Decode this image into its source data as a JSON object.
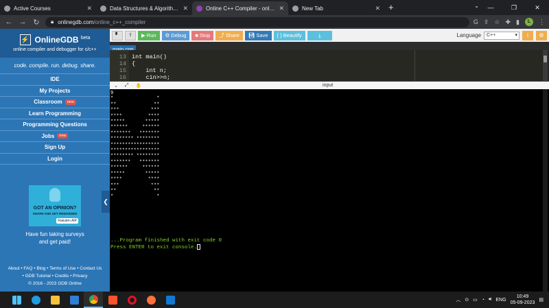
{
  "browser": {
    "tabs": [
      {
        "title": "Active Courses",
        "active": false
      },
      {
        "title": "Data Structures & Algorithms M...",
        "active": false
      },
      {
        "title": "Online C++ Compiler - online ed...",
        "active": true
      },
      {
        "title": "New Tab",
        "active": false
      }
    ],
    "url_host": "onlinegdb.com",
    "url_path": "/online_c++_compiler",
    "profile_initial": "L"
  },
  "sidebar": {
    "brand": "OnlineGDB",
    "brand_sup": "beta",
    "brand_sub": "online compiler and debugger for c/c++",
    "tagline": "code. compile. run. debug. share.",
    "nav": [
      {
        "label": "IDE",
        "badge": ""
      },
      {
        "label": "My Projects",
        "badge": ""
      },
      {
        "label": "Classroom",
        "badge": "new"
      },
      {
        "label": "Learn Programming",
        "badge": ""
      },
      {
        "label": "Programming Questions",
        "badge": ""
      },
      {
        "label": "Jobs",
        "badge": "new"
      },
      {
        "label": "Sign Up",
        "badge": ""
      },
      {
        "label": "Login",
        "badge": ""
      }
    ],
    "ad": {
      "line1": "GOT AN OPINION?",
      "line2": "SHARE AND GET REWARDED",
      "sponsor": "Rakuten AIP"
    },
    "ad_text_1": "Have fun taking surveys",
    "ad_text_2": "and get paid!",
    "footer_line1": "About • FAQ • Blog • Terms of Use • Contact Us",
    "footer_line2": "• GDB Tutorial • Credits • Privacy",
    "footer_line3": "© 2016 - 2023 GDB Online"
  },
  "toolbar": {
    "run": "Run",
    "debug": "Debug",
    "stop": "Stop",
    "share": "Share",
    "save": "Save",
    "beautify": "{ } Beautify",
    "language_label": "Language",
    "language_value": "C++"
  },
  "editor": {
    "file_tab": "main.cpp",
    "lines": [
      {
        "n": "13",
        "code": "int main()"
      },
      {
        "n": "14",
        "code": "{"
      },
      {
        "n": "15",
        "code": "    int n;"
      },
      {
        "n": "16",
        "code": "    cin>>n;"
      }
    ]
  },
  "io": {
    "input_label": "input"
  },
  "console": {
    "output": "9\n*               *\n**             **\n***           ***\n****         ****\n*****       *****\n******     ******\n*******   *******\n******** ********\n*****************\n*****************\n******** ********\n*******   *******\n******     ******\n*****       *****\n****         ****\n***           ***\n**             **\n*               *",
    "exit_line": "...Program finished with exit code 0",
    "press_line": "Press ENTER to exit console."
  },
  "taskbar": {
    "lang": "ENG",
    "time": "10:49",
    "date": "05-09-2023"
  }
}
